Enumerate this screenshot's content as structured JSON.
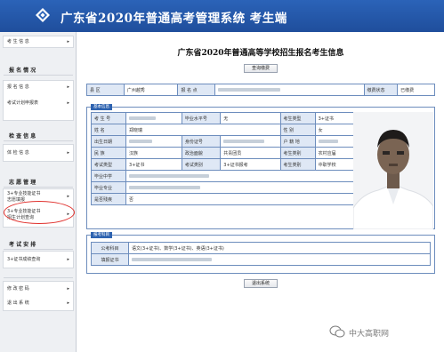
{
  "header": {
    "title": "广东省2020年普通高考管理系统  考生端"
  },
  "sidebar": {
    "item_top": "考 生 信 息",
    "group1": "报 名 情 况",
    "item_bm": "报 名 信 息",
    "item_fx": "考试计划申报表",
    "group2": "检 查 信 息",
    "item_tj": "体 检 信 息",
    "group3": "志 愿 管 理",
    "item_zy1a": "3+专业技能证书",
    "item_zy1b": "志愿填报",
    "item_zy2a": "3+专业技能证书",
    "item_zy2b": "招生计划查询",
    "group4": "考 试 安 排",
    "item_ks": "3+证书成绩查询",
    "item_xg": "修 改 密 码",
    "item_tc": "退 出 系 统",
    "arrow": "▸"
  },
  "main": {
    "title": "广东省2020年普通高等学校招生报名考生信息",
    "btn_query": "查询缴费",
    "btn_exit": "退出系统",
    "row_top": {
      "l1": "县    区",
      "v1": "广州越秀",
      "l2": "报 名 点",
      "l3": "缴费状态",
      "v3": "已缴费"
    },
    "basic_tab": "基本信息",
    "basic": {
      "r1": {
        "l1": "考 生 号",
        "l2": "毕业水平号",
        "v2": "无",
        "l3": "考生类型",
        "v3": "3+证书"
      },
      "r2": {
        "l1": "姓    名",
        "v1": "郑晓瑞",
        "l3": "性    别",
        "v3": "女"
      },
      "r3": {
        "l1": "出生日期",
        "l2": "身份证号",
        "l3": "户 籍 地"
      },
      "r4": {
        "l1": "民    族",
        "v1": "汉族",
        "l2": "政治面貌",
        "v2": "共青团员",
        "l3": "考生类别",
        "v3": "农村应届"
      },
      "r5": {
        "l1": "考试类型",
        "v1": "3+证书",
        "l2": "考试类别",
        "v2": "3+证书报考",
        "l3": "考生类别",
        "v3": "中职学校"
      },
      "r6": {
        "l1": "毕业中学"
      },
      "r7": {
        "l1": "毕业专业"
      },
      "r8": {
        "l1": "是否残疾",
        "v1": "否"
      }
    },
    "exam_tab": "报考科目",
    "exam": {
      "r1": {
        "l1": "公考科目",
        "v1": "语文(3+证书)、数学(3+证书)、英语(3+证书)"
      },
      "r2": {
        "l1": "填报证书"
      }
    }
  },
  "watermark": "中大高职网",
  "colors": {
    "header": "#1f4e9c",
    "label_bg": "#dfe8f5",
    "border": "#6d8dbd",
    "annotation": "#e0302c"
  }
}
